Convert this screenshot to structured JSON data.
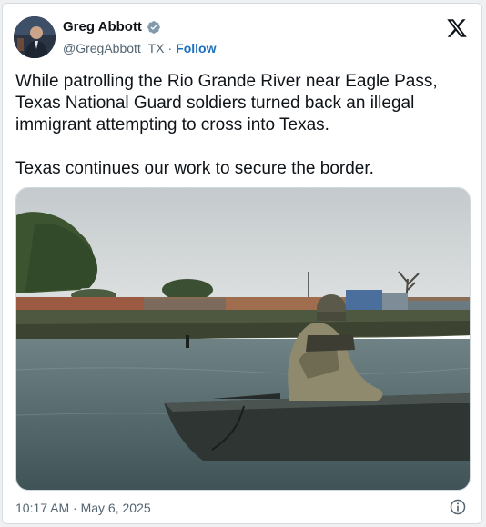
{
  "author": {
    "name": "Greg Abbott",
    "handle": "@GregAbbott_TX",
    "separator": "·",
    "follow_label": "Follow"
  },
  "tweet": {
    "paragraph1": "While patrolling the Rio Grande River near Eagle Pass, Texas National Guard soldiers turned back an illegal immigrant attempting to cross into Texas.",
    "paragraph2": "Texas continues our work to secure the border."
  },
  "meta": {
    "timestamp": "10:17 AM · May 6, 2025"
  },
  "icons": {
    "verified": "verified-badge-icon",
    "brand": "x-logo-icon",
    "info": "info-icon"
  },
  "colors": {
    "verified_blue": "#1d9bf0",
    "follow_link": "#1d6fbf",
    "secondary_text": "#536471"
  }
}
